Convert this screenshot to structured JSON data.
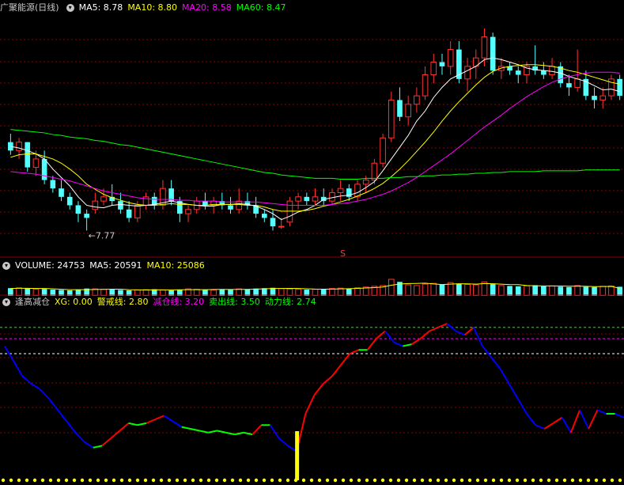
{
  "main": {
    "stock_name": "广聚能源",
    "period": "(日线)",
    "ma_labels": [
      {
        "text": "MA5: 8.78",
        "color": "#ffffff"
      },
      {
        "text": "MA10: 8.80",
        "color": "#ffff00"
      },
      {
        "text": "MA20: 8.58",
        "color": "#ff00ff"
      },
      {
        "text": "MA60: 8.47",
        "color": "#00ff00"
      }
    ],
    "low_annotation": "7.77",
    "marker": "S"
  },
  "volume": {
    "labels": [
      {
        "text": "VOLUME: 24753",
        "color": "#ffffff"
      },
      {
        "text": "MA5: 20591",
        "color": "#ffffff"
      },
      {
        "text": "MA10: 25086",
        "color": "#ffff00"
      }
    ]
  },
  "indicator": {
    "name": "逢高减仓",
    "labels": [
      {
        "text": "XG: 0.00",
        "color": "#ffff00"
      },
      {
        "text": "警戒线: 2.80",
        "color": "#ffff00"
      },
      {
        "text": "减仓线: 3.20",
        "color": "#ff00ff"
      },
      {
        "text": "卖出线: 3.50",
        "color": "#00ff00"
      },
      {
        "text": "动力线: 2.74",
        "color": "#00ff00"
      }
    ]
  },
  "chart_data": [
    {
      "type": "candlestick",
      "ylim": [
        7.5,
        10.3
      ],
      "ohlc": [
        [
          8.8,
          8.9,
          8.65,
          8.7
        ],
        [
          8.7,
          8.85,
          8.6,
          8.8
        ],
        [
          8.8,
          8.8,
          8.45,
          8.5
        ],
        [
          8.5,
          8.7,
          8.4,
          8.6
        ],
        [
          8.6,
          8.7,
          8.3,
          8.35
        ],
        [
          8.35,
          8.4,
          8.2,
          8.25
        ],
        [
          8.25,
          8.35,
          8.1,
          8.15
        ],
        [
          8.15,
          8.2,
          8.0,
          8.05
        ],
        [
          8.05,
          8.1,
          7.85,
          7.95
        ],
        [
          7.95,
          8.0,
          7.75,
          7.9
        ],
        [
          8.0,
          8.2,
          7.95,
          8.1
        ],
        [
          8.1,
          8.25,
          8.05,
          8.15
        ],
        [
          8.15,
          8.3,
          8.05,
          8.1
        ],
        [
          8.1,
          8.2,
          7.95,
          8.0
        ],
        [
          8.0,
          8.1,
          7.85,
          7.9
        ],
        [
          7.9,
          8.1,
          7.85,
          8.05
        ],
        [
          8.05,
          8.2,
          8.0,
          8.15
        ],
        [
          8.15,
          8.2,
          8.0,
          8.05
        ],
        [
          8.05,
          8.35,
          8.0,
          8.25
        ],
        [
          8.25,
          8.35,
          8.05,
          8.1
        ],
        [
          8.1,
          8.15,
          7.85,
          7.95
        ],
        [
          7.95,
          8.05,
          7.85,
          8.0
        ],
        [
          8.0,
          8.15,
          7.95,
          8.1
        ],
        [
          8.1,
          8.2,
          8.0,
          8.05
        ],
        [
          8.05,
          8.15,
          7.95,
          8.1
        ],
        [
          8.1,
          8.2,
          8.0,
          8.05
        ],
        [
          8.05,
          8.15,
          7.95,
          8.0
        ],
        [
          8.0,
          8.25,
          7.95,
          8.1
        ],
        [
          8.1,
          8.2,
          8.0,
          8.05
        ],
        [
          8.05,
          8.15,
          7.9,
          7.95
        ],
        [
          7.95,
          8.0,
          7.85,
          7.9
        ],
        [
          7.9,
          8.0,
          7.75,
          7.8
        ],
        [
          7.8,
          7.9,
          7.77,
          7.8
        ],
        [
          7.85,
          8.15,
          7.8,
          8.1
        ],
        [
          8.1,
          8.2,
          8.0,
          8.15
        ],
        [
          8.15,
          8.2,
          8.05,
          8.1
        ],
        [
          8.1,
          8.25,
          8.05,
          8.15
        ],
        [
          8.15,
          8.25,
          8.05,
          8.1
        ],
        [
          8.1,
          8.25,
          8.05,
          8.2
        ],
        [
          8.2,
          8.35,
          8.1,
          8.25
        ],
        [
          8.25,
          8.3,
          8.1,
          8.15
        ],
        [
          8.15,
          8.35,
          8.1,
          8.3
        ],
        [
          8.3,
          8.4,
          8.2,
          8.35
        ],
        [
          8.35,
          8.6,
          8.3,
          8.55
        ],
        [
          8.55,
          8.9,
          8.5,
          8.85
        ],
        [
          8.85,
          9.4,
          8.8,
          9.3
        ],
        [
          9.3,
          9.45,
          9.05,
          9.1
        ],
        [
          9.1,
          9.35,
          9.0,
          9.25
        ],
        [
          9.25,
          9.45,
          9.15,
          9.35
        ],
        [
          9.35,
          9.7,
          9.3,
          9.6
        ],
        [
          9.6,
          9.85,
          9.5,
          9.75
        ],
        [
          9.75,
          9.85,
          9.6,
          9.7
        ],
        [
          9.7,
          10.0,
          9.6,
          9.9
        ],
        [
          9.9,
          10.0,
          9.5,
          9.55
        ],
        [
          9.55,
          9.8,
          9.4,
          9.7
        ],
        [
          9.7,
          9.9,
          9.55,
          9.8
        ],
        [
          9.8,
          10.15,
          9.7,
          10.05
        ],
        [
          10.05,
          10.1,
          9.6,
          9.65
        ],
        [
          9.65,
          9.8,
          9.55,
          9.7
        ],
        [
          9.7,
          9.75,
          9.6,
          9.65
        ],
        [
          9.65,
          9.7,
          9.5,
          9.6
        ],
        [
          9.6,
          9.75,
          9.5,
          9.7
        ],
        [
          9.7,
          9.95,
          9.6,
          9.65
        ],
        [
          9.65,
          9.75,
          9.55,
          9.6
        ],
        [
          9.6,
          9.8,
          9.55,
          9.7
        ],
        [
          9.7,
          9.75,
          9.45,
          9.5
        ],
        [
          9.5,
          9.6,
          9.35,
          9.45
        ],
        [
          9.45,
          9.9,
          9.4,
          9.55
        ],
        [
          9.55,
          9.65,
          9.3,
          9.35
        ],
        [
          9.35,
          9.45,
          9.2,
          9.3
        ],
        [
          9.3,
          9.45,
          9.2,
          9.35
        ],
        [
          9.35,
          9.6,
          9.3,
          9.55
        ],
        [
          9.55,
          9.6,
          9.3,
          9.35
        ]
      ],
      "ma": {
        "MA5": [
          8.75,
          8.73,
          8.7,
          8.66,
          8.6,
          8.48,
          8.38,
          8.28,
          8.15,
          8.05,
          8.03,
          8.02,
          8.05,
          8.06,
          8.05,
          8.04,
          8.05,
          8.06,
          8.08,
          8.1,
          8.08,
          8.06,
          8.05,
          8.04,
          8.04,
          8.06,
          8.06,
          8.07,
          8.06,
          8.04,
          8.0,
          7.95,
          7.88,
          7.92,
          7.97,
          8.0,
          8.05,
          8.12,
          8.14,
          8.16,
          8.17,
          8.2,
          8.26,
          8.33,
          8.46,
          8.6,
          8.74,
          8.88,
          9.05,
          9.17,
          9.33,
          9.45,
          9.55,
          9.6,
          9.65,
          9.7,
          9.78,
          9.8,
          9.78,
          9.75,
          9.72,
          9.68,
          9.66,
          9.65,
          9.64,
          9.62,
          9.58,
          9.55,
          9.52,
          9.47,
          9.42,
          9.43,
          9.4
        ],
        "MA10": [
          8.62,
          8.65,
          8.66,
          8.66,
          8.63,
          8.6,
          8.55,
          8.48,
          8.4,
          8.3,
          8.24,
          8.18,
          8.14,
          8.11,
          8.08,
          8.06,
          8.05,
          8.05,
          8.06,
          8.07,
          8.06,
          8.06,
          8.05,
          8.05,
          8.06,
          8.06,
          8.06,
          8.06,
          8.05,
          8.05,
          8.03,
          8.0,
          7.98,
          7.98,
          7.98,
          7.99,
          8.01,
          8.04,
          8.06,
          8.09,
          8.12,
          8.16,
          8.2,
          8.25,
          8.31,
          8.39,
          8.48,
          8.58,
          8.69,
          8.8,
          8.92,
          9.05,
          9.17,
          9.28,
          9.38,
          9.48,
          9.57,
          9.64,
          9.68,
          9.7,
          9.71,
          9.72,
          9.72,
          9.71,
          9.7,
          9.68,
          9.65,
          9.63,
          9.6,
          9.57,
          9.54,
          9.51,
          9.49
        ],
        "MA20": [
          8.45,
          8.44,
          8.43,
          8.42,
          8.4,
          8.38,
          8.36,
          8.34,
          8.31,
          8.28,
          8.25,
          8.22,
          8.2,
          8.18,
          8.16,
          8.14,
          8.13,
          8.12,
          8.12,
          8.12,
          8.11,
          8.11,
          8.1,
          8.1,
          8.1,
          8.09,
          8.09,
          8.09,
          8.09,
          8.09,
          8.08,
          8.07,
          8.06,
          8.05,
          8.05,
          8.05,
          8.05,
          8.05,
          8.06,
          8.07,
          8.08,
          8.1,
          8.12,
          8.15,
          8.18,
          8.22,
          8.27,
          8.32,
          8.38,
          8.45,
          8.52,
          8.59,
          8.66,
          8.74,
          8.82,
          8.9,
          8.98,
          9.05,
          9.12,
          9.2,
          9.27,
          9.34,
          9.4,
          9.46,
          9.51,
          9.55,
          9.58,
          9.6,
          9.62,
          9.63,
          9.63,
          9.63,
          9.62
        ],
        "MA60": [
          8.95,
          8.94,
          8.93,
          8.92,
          8.91,
          8.89,
          8.88,
          8.86,
          8.85,
          8.84,
          8.82,
          8.81,
          8.79,
          8.77,
          8.76,
          8.74,
          8.72,
          8.7,
          8.68,
          8.66,
          8.64,
          8.62,
          8.6,
          8.58,
          8.56,
          8.54,
          8.52,
          8.5,
          8.48,
          8.46,
          8.44,
          8.43,
          8.41,
          8.4,
          8.39,
          8.38,
          8.37,
          8.37,
          8.37,
          8.36,
          8.36,
          8.36,
          8.37,
          8.37,
          8.37,
          8.38,
          8.38,
          8.39,
          8.39,
          8.4,
          8.4,
          8.41,
          8.41,
          8.42,
          8.42,
          8.43,
          8.43,
          8.44,
          8.44,
          8.45,
          8.45,
          8.45,
          8.45,
          8.46,
          8.46,
          8.46,
          8.46,
          8.46,
          8.47,
          8.47,
          8.47,
          8.47,
          8.47
        ]
      }
    },
    {
      "type": "bar",
      "ylim": [
        0,
        60000
      ],
      "values": [
        21000,
        22000,
        20000,
        18000,
        19000,
        17000,
        16000,
        15000,
        17000,
        20000,
        19000,
        18000,
        17000,
        16000,
        15000,
        16000,
        17000,
        18000,
        16000,
        15000,
        17000,
        19000,
        18000,
        17000,
        16000,
        18000,
        17000,
        19000,
        18000,
        20000,
        21000,
        22000,
        20000,
        19000,
        18000,
        17000,
        18000,
        19000,
        20000,
        21000,
        20000,
        22000,
        24000,
        26000,
        28000,
        45000,
        38000,
        30000,
        28000,
        32000,
        34000,
        30000,
        36000,
        33000,
        31000,
        30000,
        38000,
        32000,
        28000,
        27000,
        26000,
        27000,
        29000,
        26000,
        27000,
        25000,
        24000,
        28000,
        25000,
        24000,
        26000,
        27000,
        24753
      ],
      "ma5": [
        20000,
        20500,
        20500,
        20000,
        20000,
        19200,
        18000,
        17000,
        16800,
        17000,
        17400,
        17800,
        18200,
        18200,
        17000,
        16400,
        16200,
        16600,
        16400,
        16400,
        16600,
        17000,
        17000,
        17000,
        17400,
        17600,
        17400,
        17800,
        17600,
        18400,
        19000,
        20000,
        20200,
        20400,
        20000,
        19200,
        18400,
        18200,
        18400,
        19000,
        19600,
        20400,
        21400,
        22600,
        24000,
        29000,
        32200,
        33400,
        33800,
        34600,
        32400,
        30800,
        32000,
        33000,
        32800,
        32000,
        33600,
        33000,
        31800,
        30800,
        30600,
        28000,
        27400,
        27000,
        27000,
        26800,
        26200,
        26600,
        26000,
        25200,
        25400,
        25800,
        20591
      ]
    },
    {
      "type": "line",
      "ylim": [
        0,
        4.0
      ],
      "reference_lines": [
        2.8,
        3.2,
        3.5
      ],
      "values": [
        3.0,
        2.6,
        2.2,
        2.0,
        1.85,
        1.6,
        1.3,
        1.0,
        0.7,
        0.45,
        0.3,
        0.35,
        0.55,
        0.75,
        0.95,
        0.9,
        0.95,
        1.05,
        1.15,
        1.0,
        0.85,
        0.8,
        0.75,
        0.7,
        0.75,
        0.7,
        0.65,
        0.7,
        0.65,
        0.9,
        0.9,
        0.55,
        0.35,
        0.2,
        1.2,
        1.7,
        2.0,
        2.2,
        2.5,
        2.8,
        2.9,
        2.9,
        3.2,
        3.4,
        3.1,
        3.0,
        3.05,
        3.2,
        3.4,
        3.5,
        3.6,
        3.4,
        3.3,
        3.5,
        3.0,
        2.7,
        2.4,
        2.0,
        1.6,
        1.2,
        0.9,
        0.8,
        0.95,
        1.1,
        0.7,
        1.3,
        0.8,
        1.3,
        1.2,
        1.2,
        1.1
      ],
      "xg_index": 33,
      "xg_value": 0.0
    }
  ]
}
